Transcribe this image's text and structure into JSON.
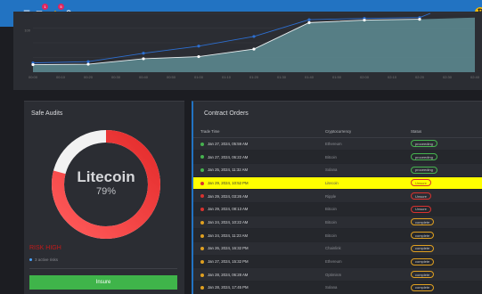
{
  "topbar": {
    "menu_icon": "☰",
    "mail_icon": "✉",
    "mail_badge": "1",
    "bell_icon": "🔔",
    "bell_badge": "5",
    "search_icon": "⚲",
    "coin_icon": "₿",
    "colors": {
      "background": "#2273c2"
    }
  },
  "chart_data": {
    "type": "line",
    "x": [
      "00:00",
      "00:10",
      "00:20",
      "00:30",
      "00:40",
      "00:50",
      "01:00",
      "01:10",
      "01:20",
      "01:30",
      "01:40",
      "01:50",
      "02:00",
      "02:10",
      "02:20",
      "02:30",
      "02:40"
    ],
    "ytick": "100",
    "series": [
      {
        "x_index": [
          0,
          2,
          4,
          6,
          8,
          10,
          12,
          14
        ],
        "values": [
          22,
          25,
          45,
          62,
          85,
          125,
          128,
          130
        ]
      },
      {
        "x_index": [
          0,
          2,
          4,
          6,
          8,
          10,
          12,
          14
        ],
        "values": [
          18,
          19,
          32,
          37,
          55,
          118,
          124,
          126
        ]
      }
    ],
    "ylim": [
      0,
      140
    ],
    "colors": {
      "line": "#2d6fd1",
      "fill": "#e8eef0",
      "area_top": "#5e8d94"
    }
  },
  "audits": {
    "title": "Safe Audits",
    "coin_name": "Litecoin",
    "percent": "79%",
    "percent_value": 0.79,
    "red_text": "RISK HIGH",
    "active_note": "3 active risks",
    "insure_label": "Insure"
  },
  "orders": {
    "title": "Contract Orders",
    "columns": [
      "Trade Time",
      "Cryptocurrency",
      "Status"
    ],
    "rows": [
      {
        "time": "Jan 27, 2024, 05:59 AM",
        "crypto": "Ethereum",
        "status": "proceeding",
        "dot": "#46b34f",
        "pill": "#46b34f"
      },
      {
        "time": "Jan 27, 2024, 06:22 AM",
        "crypto": "Bitcoin",
        "status": "proceeding",
        "dot": "#46b34f",
        "pill": "#46b34f"
      },
      {
        "time": "Jan 25, 2024, 11:32 AM",
        "crypto": "Solana",
        "status": "proceeding",
        "dot": "#46b34f",
        "pill": "#46b34f"
      },
      {
        "time": "Jan 29, 2024, 10:52 PM",
        "crypto": "Litecoin",
        "status": "Unsure",
        "dot": "#d9322f",
        "pill": "#d9322f",
        "highlight": true
      },
      {
        "time": "Jan 29, 2024, 03:26 AM",
        "crypto": "Ripple",
        "status": "Unsure",
        "dot": "#d9322f",
        "pill": "#d9322f"
      },
      {
        "time": "Jan 29, 2024, 08:13 AM",
        "crypto": "Bitcoin",
        "status": "Unsure",
        "dot": "#d9322f",
        "pill": "#d9322f"
      },
      {
        "time": "Jan 24, 2024, 10:22 AM",
        "crypto": "Bitcoin",
        "status": "complete",
        "dot": "#e0a020",
        "pill": "#e0a020"
      },
      {
        "time": "Jan 24, 2024, 11:23 AM",
        "crypto": "Bitcoin",
        "status": "complete",
        "dot": "#e0a020",
        "pill": "#e0a020"
      },
      {
        "time": "Jan 26, 2024, 16:32 PM",
        "crypto": "Chainlink",
        "status": "complete",
        "dot": "#e0a020",
        "pill": "#e0a020"
      },
      {
        "time": "Jan 27, 2024, 15:32 PM",
        "crypto": "Ethereum",
        "status": "complete",
        "dot": "#e0a020",
        "pill": "#e0a020"
      },
      {
        "time": "Jan 28, 2024, 06:28 AM",
        "crypto": "Optimism",
        "status": "complete",
        "dot": "#e0a020",
        "pill": "#e0a020"
      },
      {
        "time": "Jan 28, 2024, 17:45 PM",
        "crypto": "Solana",
        "status": "complete",
        "dot": "#e0a020",
        "pill": "#e0a020"
      }
    ],
    "highlight_color": "#ffff00"
  }
}
